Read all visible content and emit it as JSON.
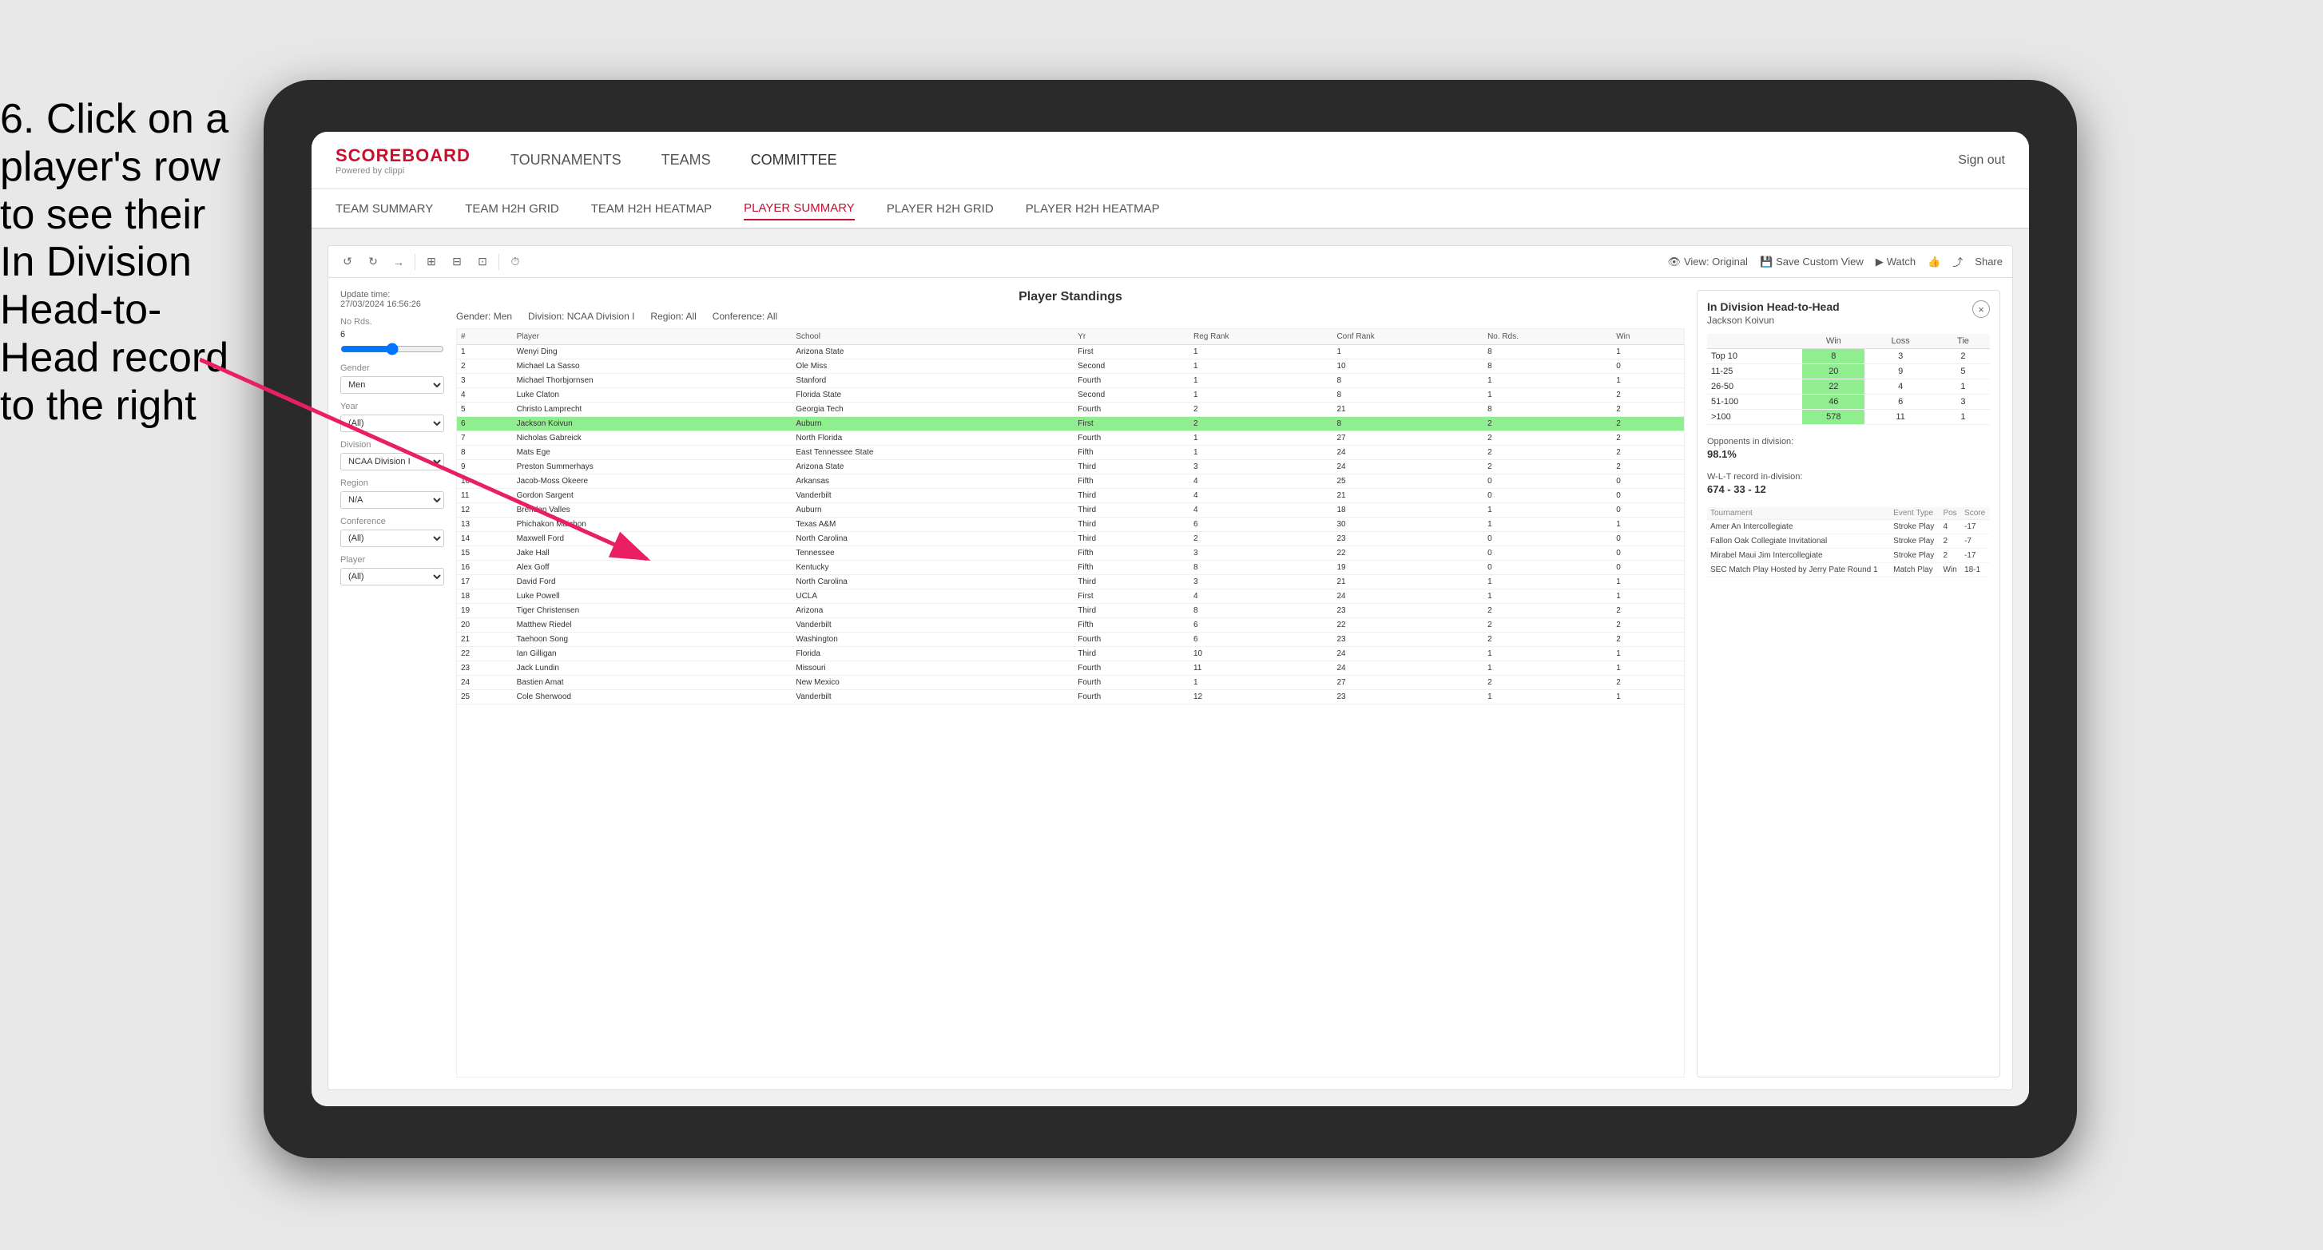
{
  "instruction": {
    "text": "6. Click on a player's row to see their In Division Head-to-Head record to the right"
  },
  "nav": {
    "logo_title": "SCOREBOARD",
    "logo_subtitle": "Powered by clippi",
    "items": [
      "TOURNAMENTS",
      "TEAMS",
      "COMMITTEE"
    ],
    "sign_out": "Sign out"
  },
  "sub_nav": {
    "items": [
      "TEAM SUMMARY",
      "TEAM H2H GRID",
      "TEAM H2H HEATMAP",
      "PLAYER SUMMARY",
      "PLAYER H2H GRID",
      "PLAYER H2H HEATMAP"
    ],
    "active": "PLAYER SUMMARY"
  },
  "toolbar": {
    "view_original": "View: Original",
    "save_custom_view": "Save Custom View",
    "watch": "Watch",
    "share": "Share"
  },
  "filter_panel": {
    "update_time_label": "Update time:",
    "update_time": "27/03/2024 16:56:26",
    "no_rds_label": "No Rds.",
    "no_rds_value": "6",
    "gender_label": "Gender",
    "gender_value": "Men",
    "year_label": "Year",
    "year_value": "(All)",
    "division_label": "Division",
    "division_value": "NCAA Division I",
    "region_label": "Region",
    "region_value": "N/A",
    "conference_label": "Conference",
    "conference_value": "(All)",
    "player_label": "Player",
    "player_value": "(All)"
  },
  "standings": {
    "title": "Player Standings",
    "gender": "Gender: Men",
    "division": "Division: NCAA Division I",
    "region": "Region: All",
    "conference": "Conference: All",
    "columns": [
      "#",
      "Player",
      "School",
      "Yr",
      "Reg Rank",
      "Conf Rank",
      "No. Rds.",
      "Win"
    ],
    "rows": [
      {
        "num": "1",
        "player": "Wenyi Ding",
        "school": "Arizona State",
        "yr": "First",
        "reg_rank": "1",
        "conf_rank": "1",
        "no_rds": "8",
        "win": "1"
      },
      {
        "num": "2",
        "player": "Michael La Sasso",
        "school": "Ole Miss",
        "yr": "Second",
        "reg_rank": "1",
        "conf_rank": "10",
        "no_rds": "8",
        "win": "0"
      },
      {
        "num": "3",
        "player": "Michael Thorbjornsen",
        "school": "Stanford",
        "yr": "Fourth",
        "reg_rank": "1",
        "conf_rank": "8",
        "no_rds": "1",
        "win": "1"
      },
      {
        "num": "4",
        "player": "Luke Claton",
        "school": "Florida State",
        "yr": "Second",
        "reg_rank": "1",
        "conf_rank": "8",
        "no_rds": "1",
        "win": "2"
      },
      {
        "num": "5",
        "player": "Christo Lamprecht",
        "school": "Georgia Tech",
        "yr": "Fourth",
        "reg_rank": "2",
        "conf_rank": "21",
        "no_rds": "8",
        "win": "2"
      },
      {
        "num": "6",
        "player": "Jackson Koivun",
        "school": "Auburn",
        "yr": "First",
        "reg_rank": "2",
        "conf_rank": "8",
        "no_rds": "2",
        "win": "2",
        "selected": true
      },
      {
        "num": "7",
        "player": "Nicholas Gabreick",
        "school": "North Florida",
        "yr": "Fourth",
        "reg_rank": "1",
        "conf_rank": "27",
        "no_rds": "2",
        "win": "2"
      },
      {
        "num": "8",
        "player": "Mats Ege",
        "school": "East Tennessee State",
        "yr": "Fifth",
        "reg_rank": "1",
        "conf_rank": "24",
        "no_rds": "2",
        "win": "2"
      },
      {
        "num": "9",
        "player": "Preston Summerhays",
        "school": "Arizona State",
        "yr": "Third",
        "reg_rank": "3",
        "conf_rank": "24",
        "no_rds": "2",
        "win": "2"
      },
      {
        "num": "10",
        "player": "Jacob-Moss Okeere",
        "school": "Arkansas",
        "yr": "Fifth",
        "reg_rank": "4",
        "conf_rank": "25",
        "no_rds": "0",
        "win": "0"
      },
      {
        "num": "11",
        "player": "Gordon Sargent",
        "school": "Vanderbilt",
        "yr": "Third",
        "reg_rank": "4",
        "conf_rank": "21",
        "no_rds": "0",
        "win": "0"
      },
      {
        "num": "12",
        "player": "Brendan Valles",
        "school": "Auburn",
        "yr": "Third",
        "reg_rank": "4",
        "conf_rank": "18",
        "no_rds": "1",
        "win": "0"
      },
      {
        "num": "13",
        "player": "Phichakon Maichon",
        "school": "Texas A&M",
        "yr": "Third",
        "reg_rank": "6",
        "conf_rank": "30",
        "no_rds": "1",
        "win": "1"
      },
      {
        "num": "14",
        "player": "Maxwell Ford",
        "school": "North Carolina",
        "yr": "Third",
        "reg_rank": "2",
        "conf_rank": "23",
        "no_rds": "0",
        "win": "0"
      },
      {
        "num": "15",
        "player": "Jake Hall",
        "school": "Tennessee",
        "yr": "Fifth",
        "reg_rank": "3",
        "conf_rank": "22",
        "no_rds": "0",
        "win": "0"
      },
      {
        "num": "16",
        "player": "Alex Goff",
        "school": "Kentucky",
        "yr": "Fifth",
        "reg_rank": "8",
        "conf_rank": "19",
        "no_rds": "0",
        "win": "0"
      },
      {
        "num": "17",
        "player": "David Ford",
        "school": "North Carolina",
        "yr": "Third",
        "reg_rank": "3",
        "conf_rank": "21",
        "no_rds": "1",
        "win": "1"
      },
      {
        "num": "18",
        "player": "Luke Powell",
        "school": "UCLA",
        "yr": "First",
        "reg_rank": "4",
        "conf_rank": "24",
        "no_rds": "1",
        "win": "1"
      },
      {
        "num": "19",
        "player": "Tiger Christensen",
        "school": "Arizona",
        "yr": "Third",
        "reg_rank": "8",
        "conf_rank": "23",
        "no_rds": "2",
        "win": "2"
      },
      {
        "num": "20",
        "player": "Matthew Riedel",
        "school": "Vanderbilt",
        "yr": "Fifth",
        "reg_rank": "6",
        "conf_rank": "22",
        "no_rds": "2",
        "win": "2"
      },
      {
        "num": "21",
        "player": "Taehoon Song",
        "school": "Washington",
        "yr": "Fourth",
        "reg_rank": "6",
        "conf_rank": "23",
        "no_rds": "2",
        "win": "2"
      },
      {
        "num": "22",
        "player": "Ian Gilligan",
        "school": "Florida",
        "yr": "Third",
        "reg_rank": "10",
        "conf_rank": "24",
        "no_rds": "1",
        "win": "1"
      },
      {
        "num": "23",
        "player": "Jack Lundin",
        "school": "Missouri",
        "yr": "Fourth",
        "reg_rank": "11",
        "conf_rank": "24",
        "no_rds": "1",
        "win": "1"
      },
      {
        "num": "24",
        "player": "Bastien Amat",
        "school": "New Mexico",
        "yr": "Fourth",
        "reg_rank": "1",
        "conf_rank": "27",
        "no_rds": "2",
        "win": "2"
      },
      {
        "num": "25",
        "player": "Cole Sherwood",
        "school": "Vanderbilt",
        "yr": "Fourth",
        "reg_rank": "12",
        "conf_rank": "23",
        "no_rds": "1",
        "win": "1"
      }
    ]
  },
  "h2h": {
    "title": "In Division Head-to-Head",
    "player_name": "Jackson Koivun",
    "close_label": "×",
    "table_headers": [
      "Win",
      "Loss",
      "Tie"
    ],
    "table_rows": [
      {
        "label": "Top 10",
        "win": "8",
        "loss": "3",
        "tie": "2"
      },
      {
        "label": "11-25",
        "win": "20",
        "loss": "9",
        "tie": "5"
      },
      {
        "label": "26-50",
        "win": "22",
        "loss": "4",
        "tie": "1"
      },
      {
        "label": "51-100",
        "win": "46",
        "loss": "6",
        "tie": "3"
      },
      {
        "label": ">100",
        "win": "578",
        "loss": "11",
        "tie": "1"
      }
    ],
    "opponents_label": "Opponents in division:",
    "wlt_label": "W-L-T record in-division:",
    "opponents_pct": "98.1%",
    "wlt_record": "674 - 33 - 12",
    "tournament_columns": [
      "Tournament",
      "Event Type",
      "Pos",
      "Score"
    ],
    "tournament_rows": [
      {
        "tournament": "Amer An Intercollegiate",
        "event_type": "Stroke Play",
        "pos": "4",
        "score": "-17"
      },
      {
        "tournament": "Fallon Oak Collegiate Invitational",
        "event_type": "Stroke Play",
        "pos": "2",
        "score": "-7"
      },
      {
        "tournament": "Mirabel Maui Jim Intercollegiate",
        "event_type": "Stroke Play",
        "pos": "2",
        "score": "-17"
      },
      {
        "tournament": "SEC Match Play Hosted by Jerry Pate Round 1",
        "event_type": "Match Play",
        "pos": "Win",
        "score": "18-1"
      }
    ]
  }
}
